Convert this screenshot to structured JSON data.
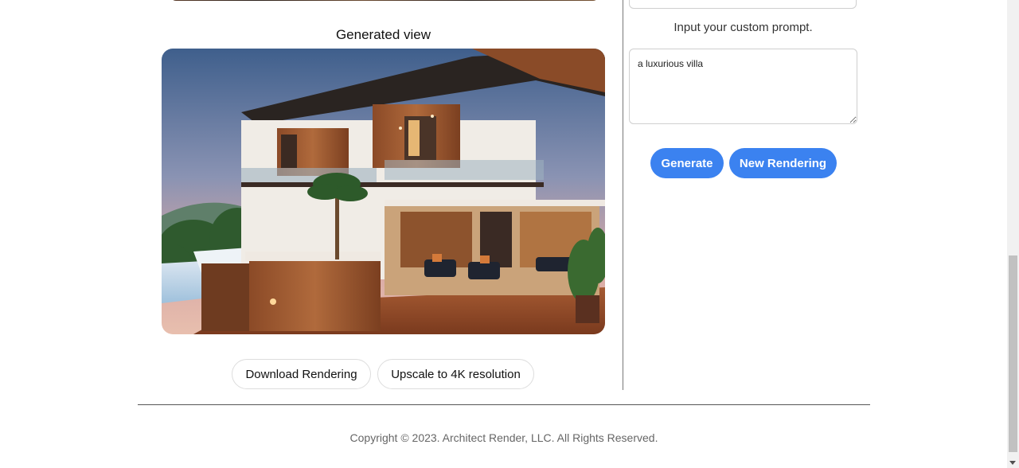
{
  "generated": {
    "title": "Generated view",
    "image_alt": "rendered luxurious villa"
  },
  "actions": {
    "download_label": "Download Rendering",
    "upscale_label": "Upscale to 4K resolution"
  },
  "prompt": {
    "label": "Input your custom prompt.",
    "value": "a luxurious villa"
  },
  "controls": {
    "generate_label": "Generate",
    "new_label": "New Rendering"
  },
  "footer": {
    "copyright": "Copyright © 2023. Architect Render, LLC. All Rights Reserved."
  },
  "colors": {
    "primary": "#3b82f0",
    "divider": "#777777"
  }
}
